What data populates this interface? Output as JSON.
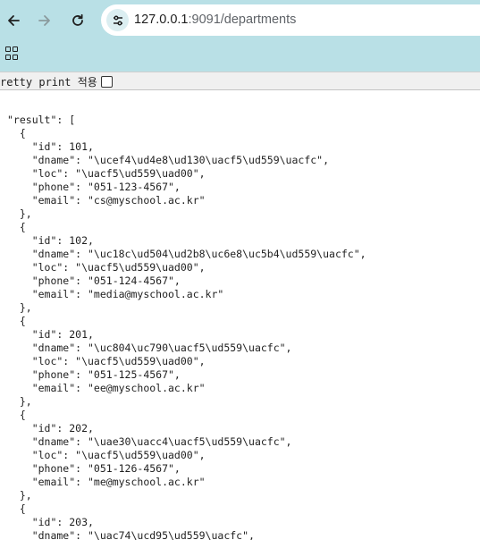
{
  "browser": {
    "url_host": "127.0.0.1",
    "url_rest": ":9091/departments",
    "icons": {
      "back": "arrow-left-icon",
      "forward": "arrow-right-icon",
      "reload": "reload-icon",
      "site_info": "tune-icon",
      "apps": "apps-grid-icon"
    }
  },
  "pretty_print": {
    "label": "retty print 적용",
    "checked": false
  },
  "json_lines": [
    "\"result\": [",
    "  {",
    "    \"id\": 101,",
    "    \"dname\": \"\\uce f4\\ud4e8\\ud130\\uacf5\\ud559\\uacfc\",",
    "    \"loc\": \"\\uacf5\\ud559\\uad00\",",
    "    \"phone\": \"051-123-4567\",",
    "    \"email\": \"cs@myschool.ac.kr\"",
    "  },",
    "  {",
    "    \"id\": 102,",
    "    \"dname\": \"\\uc18c\\ud504\\ud2b8\\uc6e8\\uc5b4\\ud559\\uacfc\",",
    "    \"loc\": \"\\uacf5\\ud559\\uad00\",",
    "    \"phone\": \"051-124-4567\",",
    "    \"email\": \"media@myschool.ac.kr\"",
    "  },",
    "  {",
    "    \"id\": 201,",
    "    \"dname\": \"\\uc804\\uc790\\uacf5\\ud559\\uacfc\",",
    "    \"loc\": \"\\uacf5\\ud559\\uad00\",",
    "    \"phone\": \"051-125-4567\",",
    "    \"email\": \"ee@myschool.ac.kr\"",
    "  },",
    "  {",
    "    \"id\": 202,",
    "    \"dname\": \"\\uae30\\uacc4\\uacf5\\ud559\\uacfc\",",
    "    \"loc\": \"\\uacf5\\ud559\\uad00\",",
    "    \"phone\": \"051-126-4567\",",
    "    \"email\": \"me@myschool.ac.kr\"",
    "  },",
    "  {",
    "    \"id\": 203,",
    "    \"dname\": \"\\uac74\\ucd95\\ud559\\uacfc\","
  ]
}
